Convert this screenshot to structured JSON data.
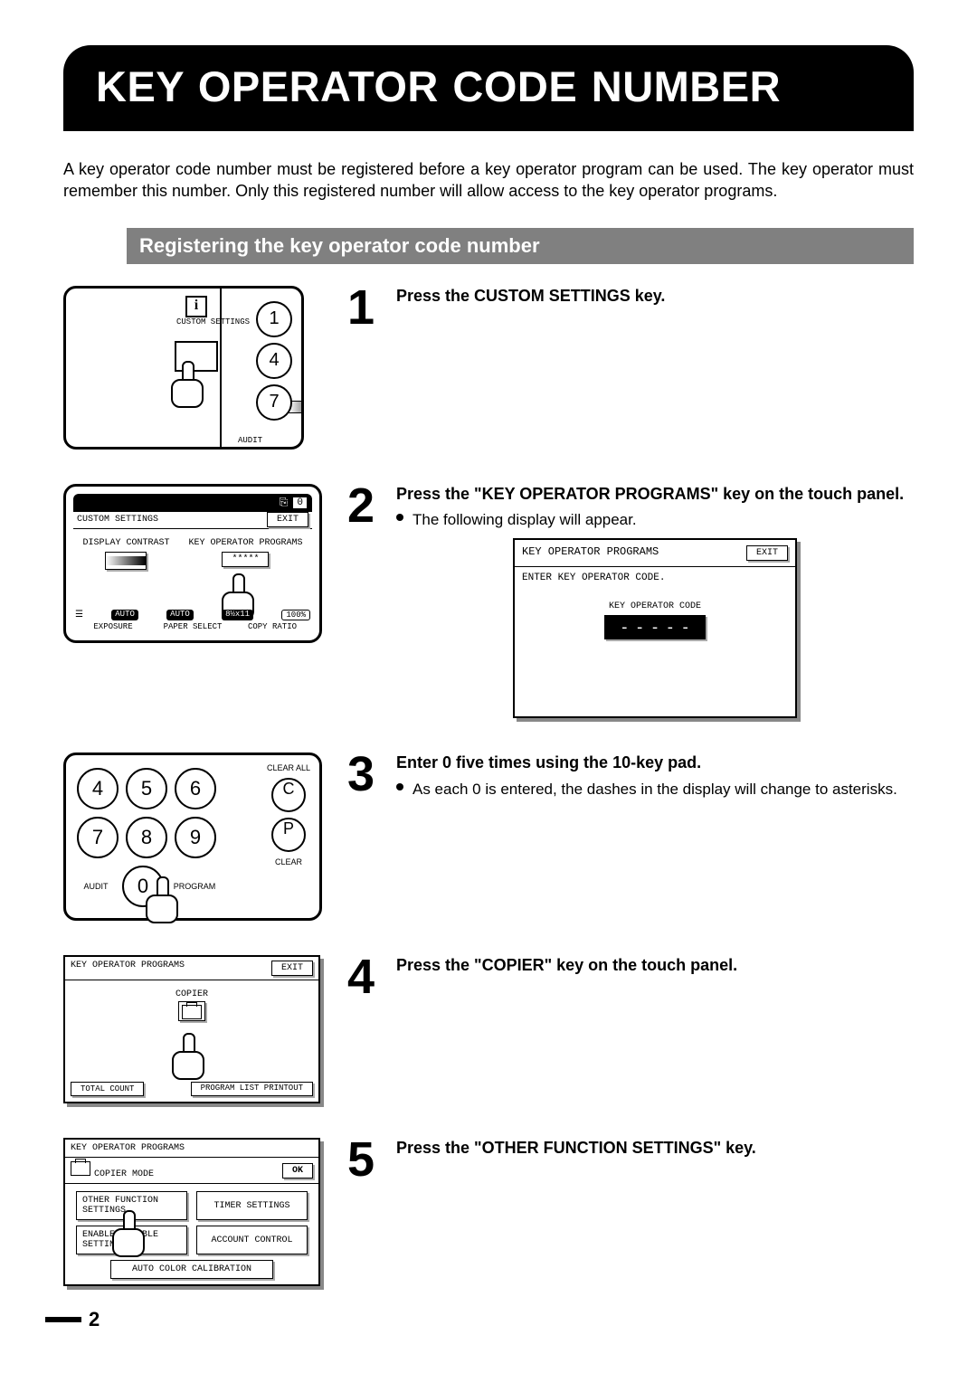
{
  "page_title": "KEY OPERATOR CODE NUMBER",
  "intro_text": "A key operator code number must be registered before a key operator program can be used. The key operator must remember this number. Only this registered number will allow access to the key operator programs.",
  "section_heading": "Registering the key operator code number",
  "page_number": "2",
  "steps": {
    "1": {
      "title": "Press the CUSTOM SETTINGS key."
    },
    "2": {
      "title": "Press the \"KEY OPERATOR PROGRAMS\" key on the touch panel.",
      "detail": "The following display will appear."
    },
    "3": {
      "title": "Enter 0 five times using the 10-key pad.",
      "detail": "As each 0 is entered, the dashes in the display will change to asterisks."
    },
    "4": {
      "title": "Press the \"COPIER\" key on the touch panel."
    },
    "5": {
      "title": "Press the \"OTHER FUNCTION SETTINGS\" key."
    }
  },
  "diagram1": {
    "custom_settings_label": "CUSTOM SETTINGS",
    "info_glyph": "i",
    "keys": [
      "1",
      "4",
      "7"
    ],
    "audit_label": "AUDIT"
  },
  "diagram2": {
    "count": "0",
    "title": "CUSTOM SETTINGS",
    "exit": "EXIT",
    "col1_label": "DISPLAY CONTRAST",
    "col2_label": "KEY OPERATOR PROGRAMS",
    "col2_value": "*****",
    "status": {
      "auto1": "AUTO",
      "auto2": "AUTO",
      "paper": "8½x11",
      "ratio": "100%"
    },
    "bottom_labels": {
      "exposure": "EXPOSURE",
      "paper_select": "PAPER SELECT",
      "copy_ratio": "COPY RATIO"
    }
  },
  "display2": {
    "header": "KEY OPERATOR PROGRAMS",
    "exit": "EXIT",
    "prompt": "ENTER KEY OPERATOR CODE.",
    "code_label": "KEY OPERATOR CODE",
    "code_value": "-----"
  },
  "diagram3": {
    "rows": [
      [
        "4",
        "5",
        "6"
      ],
      [
        "7",
        "8",
        "9"
      ]
    ],
    "zero": "0",
    "audit": "AUDIT",
    "program": "PROGRAM",
    "clear_all": "CLEAR ALL",
    "c_key": "C",
    "p_key": "P",
    "clear": "CLEAR"
  },
  "diagram4": {
    "header": "KEY OPERATOR PROGRAMS",
    "exit": "EXIT",
    "copier": "COPIER",
    "total_count": "TOTAL COUNT",
    "program_list": "PROGRAM LIST PRINTOUT"
  },
  "diagram5": {
    "header": "KEY OPERATOR PROGRAMS",
    "ok": "OK",
    "mode_label": "COPIER MODE",
    "buttons": {
      "other_function": "OTHER FUNCTION SETTINGS",
      "timer": "TIMER SETTINGS",
      "enable_disable": "ENABLE/DISABLE SETTINGS",
      "account": "ACCOUNT CONTROL",
      "auto_color": "AUTO COLOR CALIBRATION"
    }
  }
}
